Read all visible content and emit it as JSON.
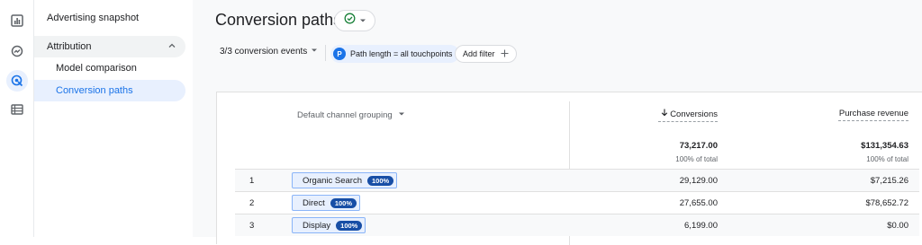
{
  "sidebar": {
    "top_item": "Advertising snapshot",
    "section": "Attribution",
    "sub_items": [
      "Model comparison",
      "Conversion paths"
    ]
  },
  "page": {
    "title": "Conversion paths"
  },
  "filters": {
    "events_label": "3/3 conversion events",
    "chip_letter": "P",
    "chip_label": "Path length = all touchpoints",
    "add_filter": "Add filter"
  },
  "table": {
    "dimension_header": "Default channel grouping",
    "metric_headers": [
      "Conversions",
      "Purchase revenue"
    ],
    "totals": {
      "conversions": "73,217.00",
      "conversions_pct": "100% of total",
      "revenue": "$131,354.63",
      "revenue_pct": "100% of total"
    },
    "rows": [
      {
        "num": "1",
        "path": "Organic Search",
        "pct": "100%",
        "conversions": "29,129.00",
        "revenue": "$7,215.26"
      },
      {
        "num": "2",
        "path": "Direct",
        "pct": "100%",
        "conversions": "27,655.00",
        "revenue": "$78,652.72"
      },
      {
        "num": "3",
        "path": "Display",
        "pct": "100%",
        "conversions": "6,199.00",
        "revenue": "$0.00"
      }
    ]
  },
  "icons": [
    "reports-icon",
    "explore-icon",
    "advertising-icon",
    "configure-icon",
    "check-circle-icon",
    "chevron-down-icon",
    "chevron-up-icon",
    "plus-icon",
    "arrow-down-icon"
  ],
  "colors": {
    "accent": "#1a73e8",
    "badge": "#174ea6",
    "active_bg": "#e8f0fe"
  }
}
